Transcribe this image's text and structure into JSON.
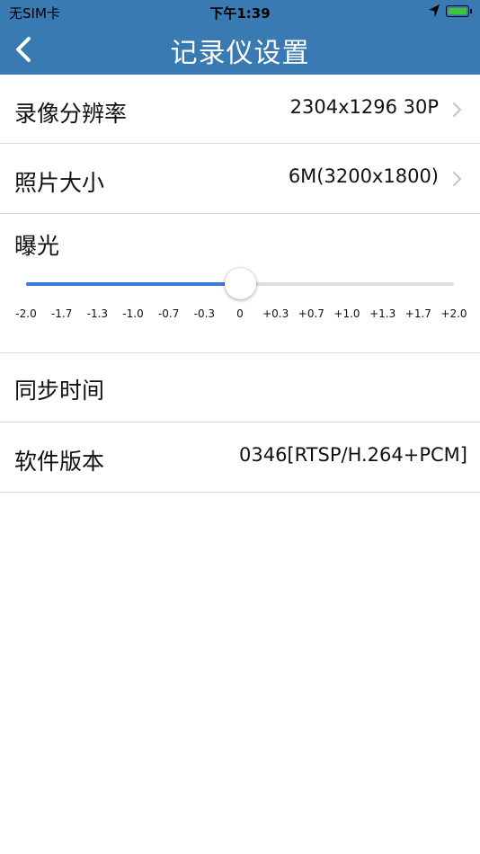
{
  "status_bar": {
    "carrier": "无SIM卡",
    "time": "下午1:39",
    "icons": [
      "location-arrow-icon",
      "battery-charging-icon"
    ]
  },
  "nav": {
    "title": "记录仪设置",
    "back_icon": "chevron-left-icon"
  },
  "settings": {
    "resolution": {
      "label": "录像分辨率",
      "value": "2304x1296 30P"
    },
    "photo_size": {
      "label": "照片大小",
      "value": "6M(3200x1800)"
    },
    "exposure": {
      "label": "曝光",
      "ticks": [
        "-2.0",
        "-1.7",
        "-1.3",
        "-1.0",
        "-0.7",
        "-0.3",
        "0",
        "+0.3",
        "+0.7",
        "+1.0",
        "+1.3",
        "+1.7",
        "+2.0"
      ],
      "selected_index": 6,
      "selected_value": "0"
    },
    "sync_time": {
      "label": "同步时间"
    },
    "firmware": {
      "label": "软件版本",
      "value": "0346[RTSP/H.264+PCM]"
    }
  },
  "colors": {
    "nav_background": "#3a7ab3",
    "slider_active": "#3a7bd5",
    "slider_inactive": "#dedede",
    "separator": "#dcdcdc",
    "chevron": "#c7c7cc"
  }
}
